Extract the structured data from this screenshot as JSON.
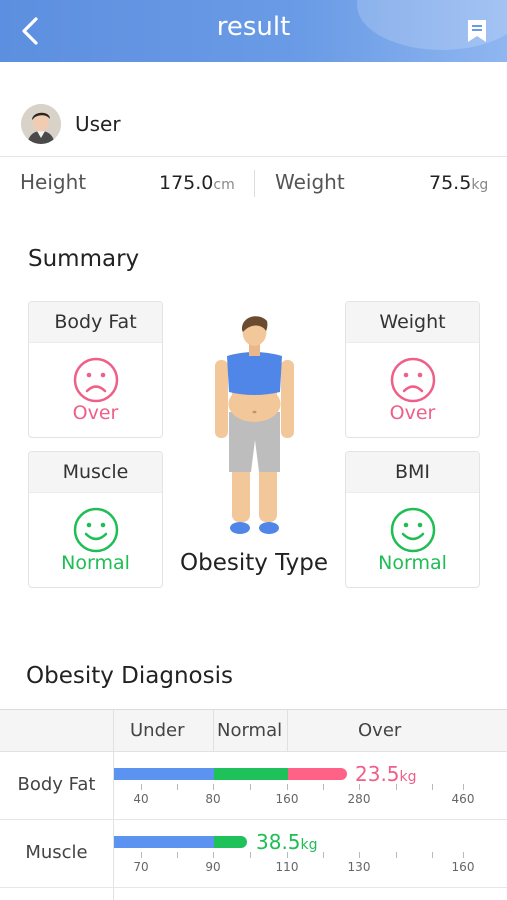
{
  "header": {
    "title": "result",
    "back_icon": "chevron-left-icon",
    "bookmark_icon": "bookmark-icon"
  },
  "user": {
    "name": "User"
  },
  "measurements": {
    "height_label": "Height",
    "height_value": "175.0",
    "height_unit": "cm",
    "weight_label": "Weight",
    "weight_value": "75.5",
    "weight_unit": "kg"
  },
  "summary": {
    "title": "Summary",
    "cards": [
      {
        "label": "Body Fat",
        "status": "Over",
        "face": "sad-face-icon"
      },
      {
        "label": "Weight",
        "status": "Over",
        "face": "sad-face-icon"
      },
      {
        "label": "Muscle",
        "status": "Normal",
        "face": "smile-face-icon"
      },
      {
        "label": "BMI",
        "status": "Normal",
        "face": "smile-face-icon"
      }
    ],
    "figure_label": "Obesity Type"
  },
  "diagnosis": {
    "title": "Obesity Diagnosis",
    "columns": [
      "Under",
      "Normal",
      "Over"
    ],
    "rows": [
      {
        "label": "Body Fat",
        "value": "23.5",
        "unit": "kg",
        "status": "Over",
        "ticks": [
          "40",
          "80",
          "160",
          "280",
          "460"
        ]
      },
      {
        "label": "Muscle",
        "value": "38.5",
        "unit": "kg",
        "status": "Normal",
        "ticks": [
          "70",
          "90",
          "110",
          "130",
          "160"
        ]
      }
    ]
  },
  "colors": {
    "header": "#6a9be6",
    "over": "#ef5f88",
    "normal": "#1fbe55",
    "under_bar": "#5b93f0"
  }
}
